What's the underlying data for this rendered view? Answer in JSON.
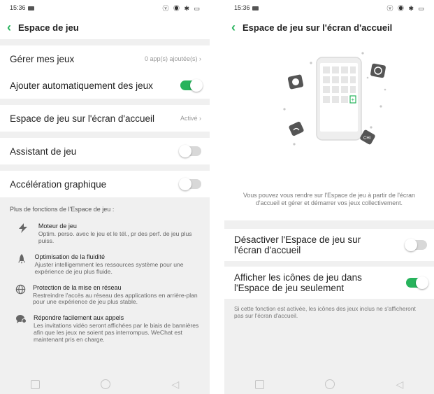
{
  "left": {
    "status_time": "15:36",
    "status_icons": "ⓥ ◉ ✱ ▭",
    "title": "Espace de jeu",
    "rows": {
      "manage": {
        "label": "Gérer mes jeux",
        "value": "0 app(s) ajoutée(s) ›"
      },
      "auto_add": {
        "label": "Ajouter automatiquement des jeux",
        "on": true
      },
      "home": {
        "label": "Espace de jeu sur l'écran d'accueil",
        "value": "Activé ›"
      },
      "assistant": {
        "label": "Assistant de jeu",
        "on": false
      },
      "accel": {
        "label": "Accélération graphique",
        "on": false
      }
    },
    "features_title": "Plus de fonctions de l'Espace de jeu :",
    "features": [
      {
        "icon": "lightning-icon",
        "title": "Moteur de jeu",
        "desc": "Optim. perso. avec le jeu et le tél., pr des perf. de jeu plus puiss."
      },
      {
        "icon": "rocket-icon",
        "title": "Optimisation de la fluidité",
        "desc": "Ajuster intelligemment les ressources système pour une expérience de jeu plus fluide."
      },
      {
        "icon": "globe-icon",
        "title": "Protection de la mise en réseau",
        "desc": "Restreindre l'accès au réseau des applications en arrière-plan pour une expérience de jeu plus stable."
      },
      {
        "icon": "chat-icon",
        "title": "Répondre facilement aux appels",
        "desc": "Les invitations vidéo seront affichées par le biais de bannières afin que les jeux ne soient pas interrompus. WeChat est maintenant pris en charge."
      }
    ]
  },
  "right": {
    "status_time": "15:36",
    "status_icons": "ⓥ ◉ ✱ ▭",
    "title": "Espace de jeu sur l'écran d'accueil",
    "description": "Vous pouvez vous rendre sur l'Espace de jeu à partir de l'écran d'accueil et gérer et démarrer vos jeux collectivement.",
    "rows": {
      "disable": {
        "label": "Désactiver l'Espace de jeu sur l'écran d'accueil",
        "on": false
      },
      "only_space": {
        "label": "Afficher les icônes de jeu dans l'Espace de jeu seulement",
        "on": true
      }
    },
    "note": "Si cette fonction est activée, les icônes des jeux inclus ne s'afficheront pas sur l'écran d'accueil."
  },
  "navbar": {
    "back_glyph": "◁"
  },
  "colors": {
    "accent": "#27b35c",
    "background": "#f0f0f0"
  }
}
